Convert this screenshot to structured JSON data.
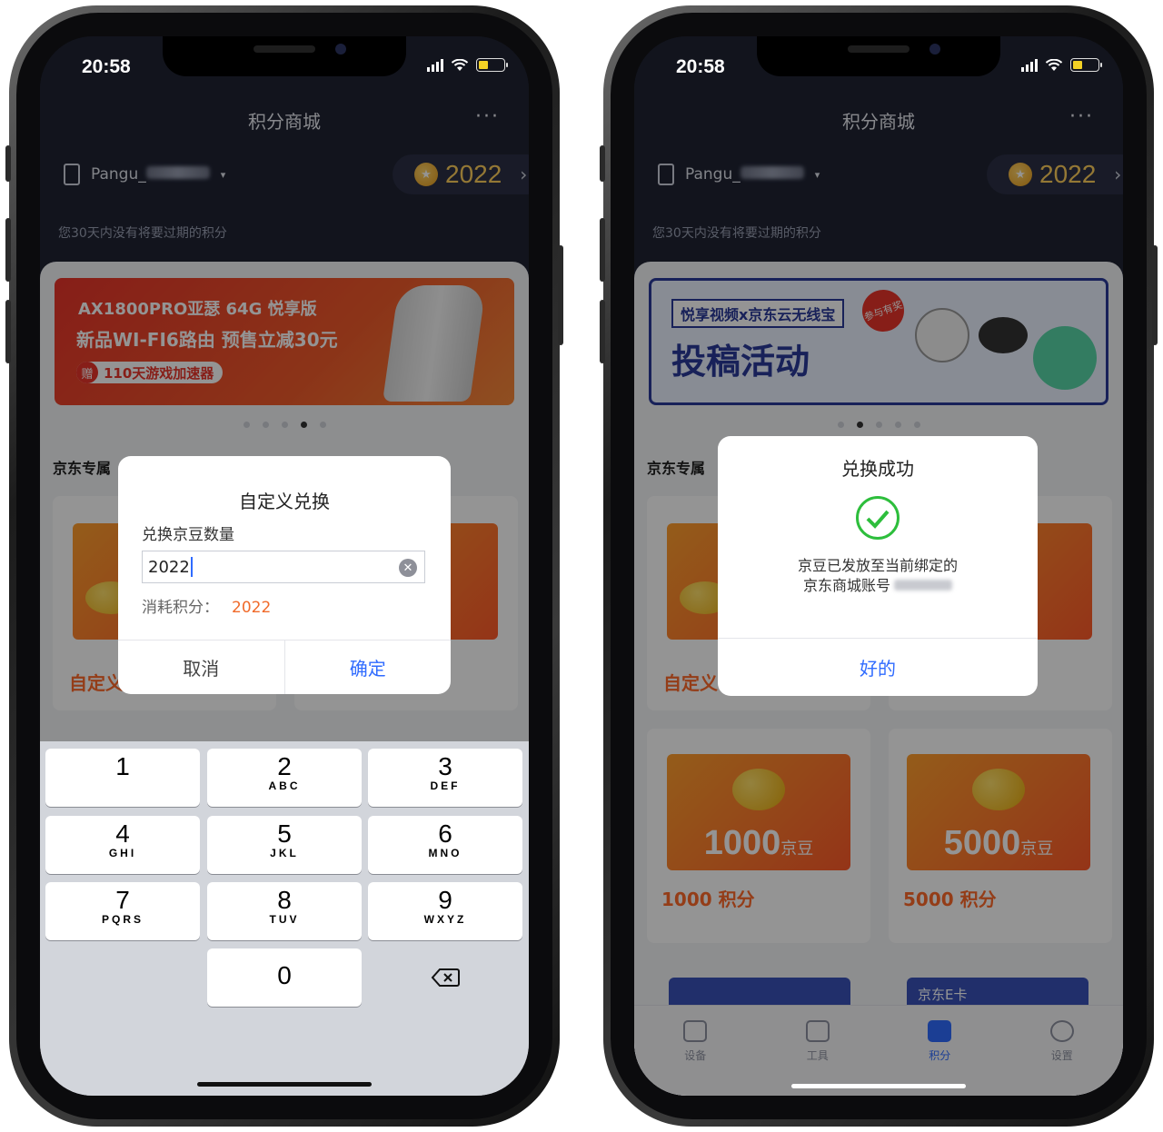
{
  "left_phone": {
    "status": {
      "time": "20:58"
    },
    "header": {
      "title": "积分商城",
      "more": "···"
    },
    "device": {
      "name": "Pangu_",
      "caret": "▾"
    },
    "points": {
      "value": "2022",
      "arrow": "›"
    },
    "expire_note": "您30天内没有将要过期的积分",
    "banner": {
      "line1": "AX1800PRO亚瑟 64G 悦享版",
      "line2": "新品WI-FI6路由 预售立减30元",
      "badge_icon": "赠",
      "badge_text": "110天游戏加速器",
      "active_dot": 4,
      "dot_count": 5
    },
    "section_title": "京东专属",
    "custom_label": "自定义",
    "dialog": {
      "title": "自定义兑换",
      "field_label": "兑换京豆数量",
      "input_value": "2022",
      "consume_label": "消耗积分：",
      "consume_value": "2022",
      "cancel": "取消",
      "confirm": "确定"
    },
    "keypad": [
      {
        "digit": "1",
        "letters": ""
      },
      {
        "digit": "2",
        "letters": "ABC"
      },
      {
        "digit": "3",
        "letters": "DEF"
      },
      {
        "digit": "4",
        "letters": "GHI"
      },
      {
        "digit": "5",
        "letters": "JKL"
      },
      {
        "digit": "6",
        "letters": "MNO"
      },
      {
        "digit": "7",
        "letters": "PQRS"
      },
      {
        "digit": "8",
        "letters": "TUV"
      },
      {
        "digit": "9",
        "letters": "WXYZ"
      },
      {
        "digit": "0",
        "letters": ""
      }
    ]
  },
  "right_phone": {
    "status": {
      "time": "20:58"
    },
    "header": {
      "title": "积分商城",
      "more": "···"
    },
    "device": {
      "name": "Pangu_",
      "caret": "▾"
    },
    "points": {
      "value": "2022",
      "arrow": "›"
    },
    "expire_note": "您30天内没有将要过期的积分",
    "banner": {
      "line1": "悦享视频x京东云无线宝",
      "line2": "投稿活动",
      "tag": "参与有奖",
      "active_dot": 2,
      "dot_count": 5
    },
    "section_title": "京东专属",
    "custom_label": "自定义",
    "tiles": [
      {
        "amount": "1000",
        "unit": "京豆",
        "cost": "1000 积分"
      },
      {
        "amount": "5000",
        "unit": "京豆",
        "cost": "5000 积分"
      }
    ],
    "ecard_label": "京东E卡",
    "dialog": {
      "title": "兑换成功",
      "message_line1": "京豆已发放至当前绑定的",
      "message_line2": "京东商城账号",
      "ok": "好的"
    },
    "tabs": [
      {
        "label": "设备",
        "icon": "router-icon"
      },
      {
        "label": "工具",
        "icon": "toolbox-icon"
      },
      {
        "label": "积分",
        "icon": "gift-icon",
        "active": true
      },
      {
        "label": "设置",
        "icon": "gear-icon"
      }
    ]
  },
  "colors": {
    "accent_blue": "#2f6bff",
    "orange": "#ff6a2a",
    "coin_yellow": "#ffcf5c",
    "success_green": "#2dbe3c"
  }
}
